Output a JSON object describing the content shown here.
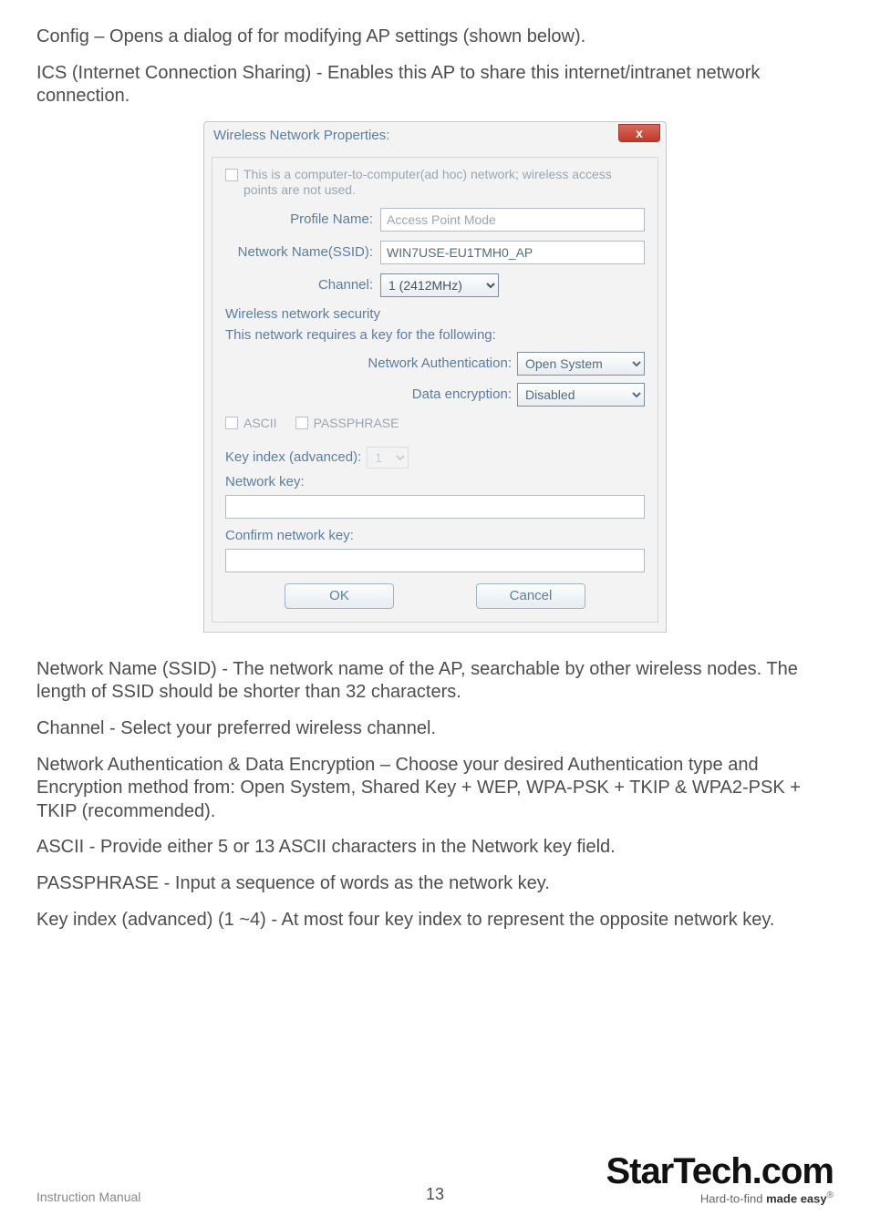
{
  "intro": {
    "p1": "Config – Opens a dialog of for modifying AP settings (shown below).",
    "p2": "ICS (Internet Connection Sharing) - Enables this AP to share this internet/intranet network connection."
  },
  "dialog": {
    "title": "Wireless Network Properties:",
    "close_glyph": "x",
    "adhoc_text": "This is a computer-to-computer(ad hoc) network; wireless access points are not used.",
    "profile_name_label": "Profile Name:",
    "profile_name_value": "Access Point Mode",
    "ssid_label": "Network Name(SSID):",
    "ssid_value": "WIN7USE-EU1TMH0_AP",
    "channel_label": "Channel:",
    "channel_value": "1 (2412MHz)",
    "security_heading": "Wireless network security",
    "requires_text": "This network requires a key for the following:",
    "auth_label": "Network Authentication:",
    "auth_value": "Open System",
    "enc_label": "Data encryption:",
    "enc_value": "Disabled",
    "ascii_label": "ASCII",
    "passphrase_label": "PASSPHRASE",
    "key_index_label": "Key index (advanced):",
    "key_index_value": "1",
    "network_key_label": "Network key:",
    "confirm_key_label": "Confirm network key:",
    "ok_label": "OK",
    "cancel_label": "Cancel"
  },
  "explain": {
    "p1": "Network Name (SSID) - The network name of the AP, searchable by other wireless nodes. The length of SSID should be shorter than 32 characters.",
    "p2": "Channel - Select your preferred wireless channel.",
    "p3": "Network Authentication & Data Encryption – Choose your desired Authentication type and Encryption method from: Open System, Shared Key + WEP, WPA-PSK + TKIP & WPA2-PSK + TKIP (recommended).",
    "p4": "ASCII - Provide either 5 or 13 ASCII characters in the Network key field.",
    "p5": "PASSPHRASE - Input a sequence of words as the network key.",
    "p6": "Key index (advanced) (1 ~4) - At most four key index to represent the opposite network key."
  },
  "footer": {
    "left": "Instruction Manual",
    "page": "13",
    "brand": "StarTech",
    "brand_suffix": ".com",
    "tagline_prefix": "Hard-to-find ",
    "tagline_bold": "made easy",
    "reg": "®"
  }
}
